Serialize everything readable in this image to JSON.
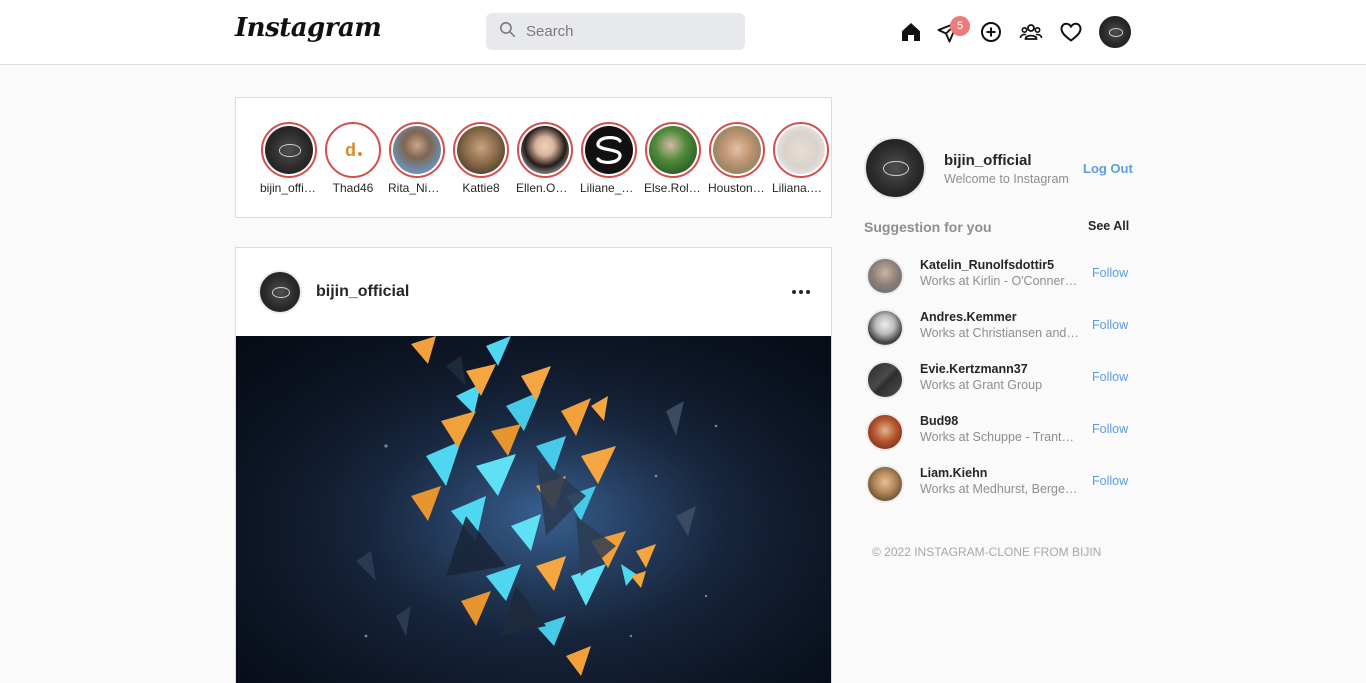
{
  "brand": {
    "name": "Instagram"
  },
  "search": {
    "placeholder": "Search"
  },
  "nav": {
    "direct_badge": "5",
    "icons": [
      "home-icon",
      "direct-icon",
      "new-post-icon",
      "explore-people-icon",
      "activity-heart-icon",
      "profile-avatar"
    ]
  },
  "stories": [
    {
      "name": "bijin_official",
      "style": "dark"
    },
    {
      "name": "Thad46",
      "style": "logo-d"
    },
    {
      "name": "Rita_Nienow",
      "style": "photo",
      "color": "#6f8fb0"
    },
    {
      "name": "Kattie8",
      "style": "photo",
      "color": "#8a6b4a"
    },
    {
      "name": "Ellen.Ondricka",
      "style": "photo",
      "color": "#3a2c2a"
    },
    {
      "name": "Liliane_Hahn",
      "style": "logo-s"
    },
    {
      "name": "Else.Rolfson",
      "style": "photo",
      "color": "#4f8a3a"
    },
    {
      "name": "Houston.Kub",
      "style": "photo",
      "color": "#a58868"
    },
    {
      "name": "Liliana.Keebler",
      "style": "photo",
      "color": "#d9d2cc"
    }
  ],
  "post": {
    "username": "bijin_official",
    "more_label": "more options"
  },
  "profile": {
    "username": "bijin_official",
    "subtitle": "Welcome to Instagram",
    "logout": "Log Out"
  },
  "suggestions": {
    "title": "Suggestion for you",
    "see_all": "See All",
    "items": [
      {
        "name": "Katelin_Runolfsdottir5",
        "sub": "Works at Kirlin - O'Conner and Kessler",
        "follow": "Follow",
        "color": "#8a7d74"
      },
      {
        "name": "Andres.Kemmer",
        "sub": "Works at Christiansen and Sons",
        "follow": "Follow",
        "color": "#7a7a7a"
      },
      {
        "name": "Evie.Kertzmann37",
        "sub": "Works at Grant Group",
        "follow": "Follow",
        "color": "#3c3c3c"
      },
      {
        "name": "Bud98",
        "sub": "Works at Schuppe - Trantow Group",
        "follow": "Follow",
        "color": "#9a4a2c"
      },
      {
        "name": "Liam.Kiehn",
        "sub": "Works at Medhurst, Berge and Kling",
        "follow": "Follow",
        "color": "#8b6a3e"
      }
    ]
  },
  "footer": {
    "text": "© 2022 INSTAGRAM-CLONE FROM BIJIN"
  }
}
